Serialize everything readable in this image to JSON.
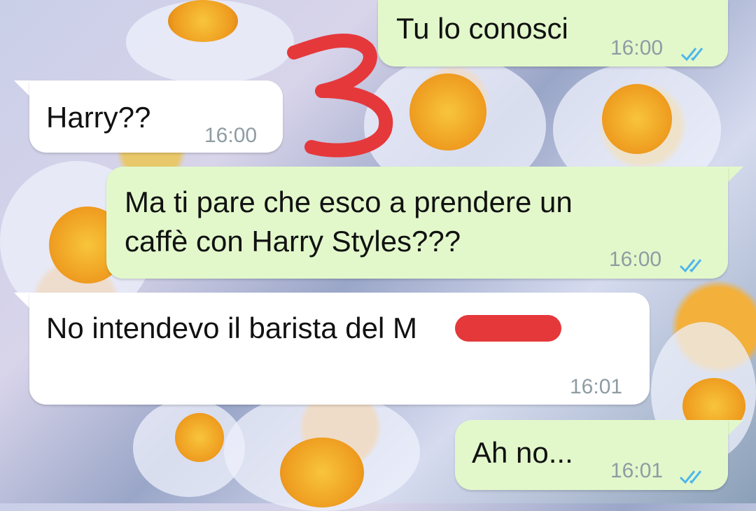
{
  "messages": [
    {
      "text": "Tu lo conosci",
      "time": "16:00"
    },
    {
      "text": "Harry??",
      "time": "16:00"
    },
    {
      "text_line1": "Ma ti pare che esco a prendere un",
      "text_line2": "caffè con Harry Styles???",
      "time": "16:00"
    },
    {
      "text": "No intendevo il barista del M",
      "time": "16:01"
    },
    {
      "text": "Ah no...",
      "time": "16:01"
    }
  ],
  "annotation": {
    "mark": "3",
    "color": "#e5383b"
  },
  "colors": {
    "outgoing_bubble": "#e2f8cb",
    "incoming_bubble": "#ffffff",
    "read_ticks": "#4fb6ec",
    "timestamp": "#8f9ca3",
    "redaction": "#e5383b"
  },
  "icons": {
    "read_receipt": "double-check-icon"
  }
}
